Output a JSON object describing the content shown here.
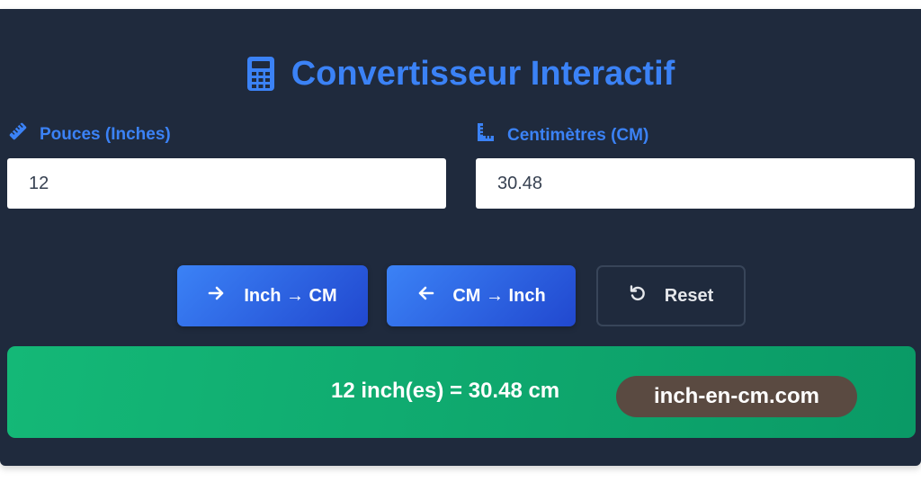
{
  "app": {
    "title": "Convertisseur Interactif"
  },
  "inputs": {
    "inches": {
      "label": "Pouces (Inches)",
      "value": "12",
      "icon": "ruler-icon"
    },
    "cm": {
      "label": "Centimètres (CM)",
      "value": "30.48",
      "icon": "ruler-combined-icon"
    }
  },
  "buttons": {
    "inch_to_cm": {
      "label": "Inch → CM",
      "icon": "arrow-right-icon"
    },
    "cm_to_inch": {
      "label": "CM → Inch",
      "icon": "arrow-left-icon"
    },
    "reset": {
      "label": "Reset",
      "icon": "undo-icon"
    }
  },
  "result": {
    "text": "12 inch(es) = 30.48 cm"
  },
  "watermark": {
    "text": "inch-en-cm.com"
  },
  "colors": {
    "panel_bg": "#1f2a3d",
    "accent": "#3b82f6",
    "button_gradient_end": "#2148cf",
    "result_green": "#10b981",
    "watermark_bg": "#5a4a41"
  }
}
